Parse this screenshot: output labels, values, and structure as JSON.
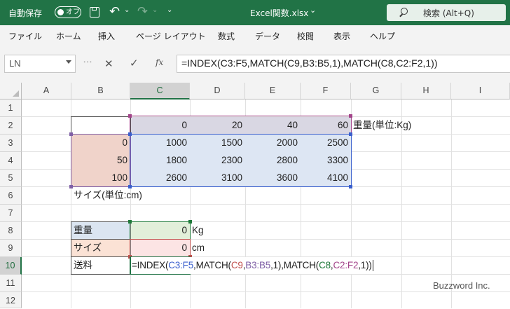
{
  "titlebar": {
    "autosave_label": "自動保存",
    "autosave_state": "オフ",
    "filename": "Excel関数.xlsx",
    "filename_caret": "⌄",
    "search_placeholder": "検索 (Alt+Q)"
  },
  "menu": {
    "items": [
      "ファイル",
      "ホーム",
      "挿入",
      "ページ レイアウト",
      "数式",
      "データ",
      "校閲",
      "表示",
      "ヘルプ"
    ]
  },
  "formula_bar": {
    "name_box": "LN",
    "cancel_icon": "✕",
    "enter_icon": "✓",
    "fx_label": "fx",
    "formula": "=INDEX(C3:F5,MATCH(C9,B3:B5,1),MATCH(C8,C2:F2,1))"
  },
  "columns": [
    "A",
    "B",
    "C",
    "D",
    "E",
    "F",
    "G",
    "H",
    "I"
  ],
  "rows": [
    "1",
    "2",
    "3",
    "4",
    "5",
    "6",
    "7",
    "8",
    "9",
    "10",
    "11",
    "12"
  ],
  "cells": {
    "C2": "0",
    "D2": "20",
    "E2": "40",
    "F2": "60",
    "G2": "重量(単位:Kg)",
    "B3": "0",
    "C3": "1000",
    "D3": "1500",
    "E3": "2000",
    "F3": "2500",
    "B4": "50",
    "C4": "1800",
    "D4": "2300",
    "E4": "2800",
    "F4": "3300",
    "B5": "100",
    "C5": "2600",
    "D5": "3100",
    "E5": "3600",
    "F5": "4100",
    "B6": "サイズ(単位:cm)",
    "B8": "重量",
    "C8": "0",
    "D8": "Kg",
    "B9": "サイズ",
    "C9": "0",
    "D9": "cm",
    "B10": "送料"
  },
  "edit_formula": {
    "parts": [
      {
        "text": "=INDEX(",
        "color": "#222222"
      },
      {
        "text": "C3:F5",
        "color": "#3a5fcd"
      },
      {
        "text": ",MATCH(",
        "color": "#222222"
      },
      {
        "text": "C9",
        "color": "#c0504d"
      },
      {
        "text": ",",
        "color": "#222222"
      },
      {
        "text": "B3:B5",
        "color": "#7f5fa6"
      },
      {
        "text": ",1),MATCH(",
        "color": "#222222"
      },
      {
        "text": "C8",
        "color": "#1f7a3a"
      },
      {
        "text": ",",
        "color": "#222222"
      },
      {
        "text": "C2:F2",
        "color": "#a3448a"
      },
      {
        "text": ",1))",
        "color": "#222222"
      }
    ]
  },
  "watermark": "Buzzword Inc.",
  "colors": {
    "excel_green": "#217346",
    "ref_c3f5": "#3a5fcd",
    "ref_c9": "#c0504d",
    "ref_b3b5": "#7f5fa6",
    "ref_c8": "#1f7a3a",
    "ref_c2f2": "#a3448a"
  }
}
